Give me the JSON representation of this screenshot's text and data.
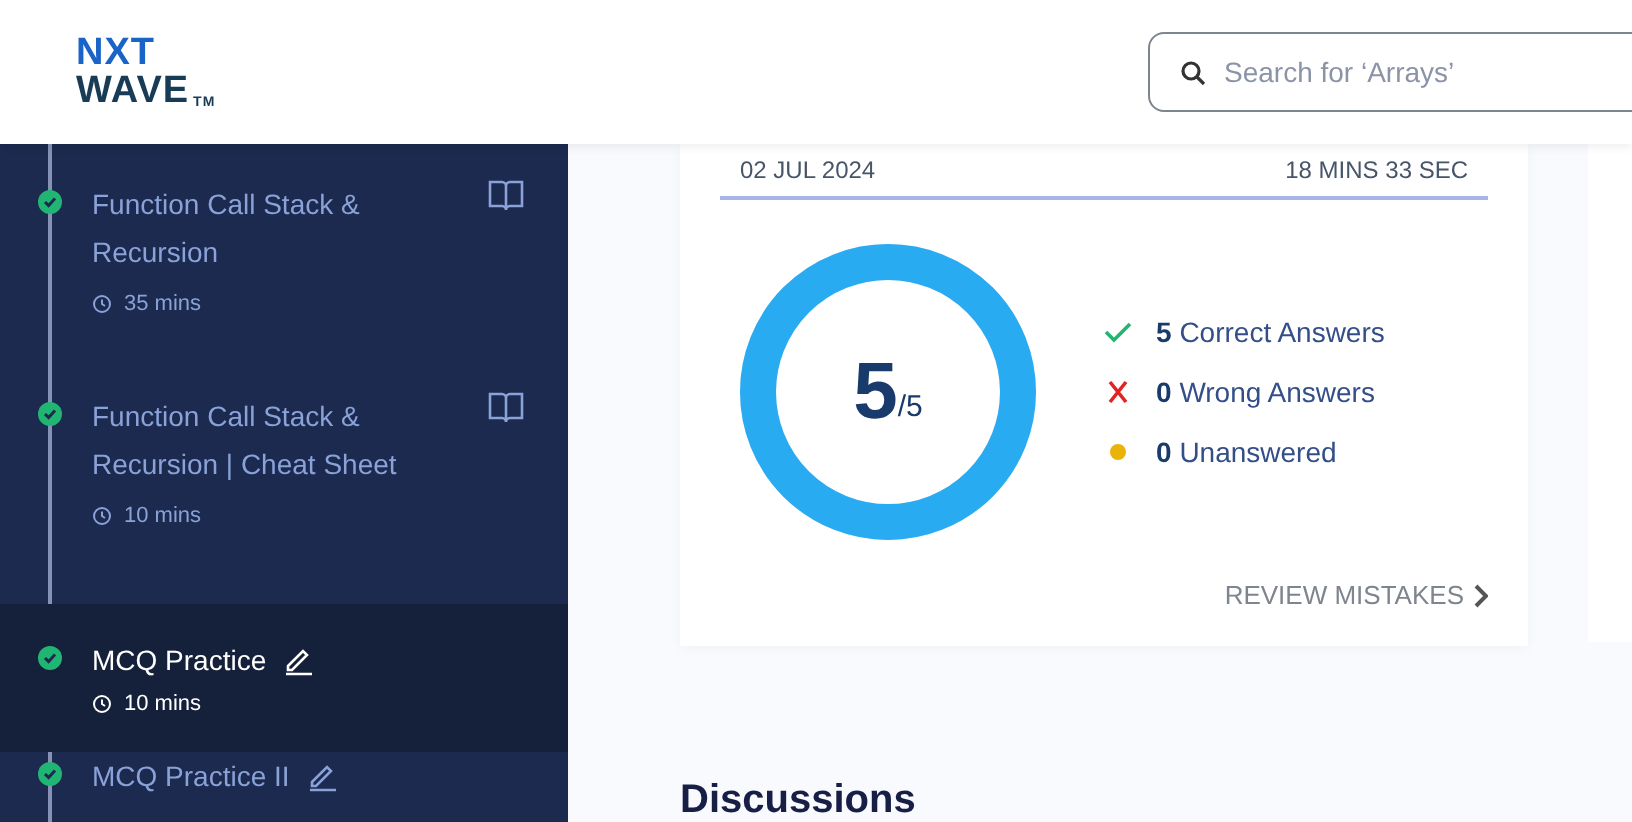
{
  "header": {
    "logo": {
      "line1": "NXT",
      "line2": "WAVE",
      "mark": "TM"
    },
    "search": {
      "placeholder": "Search for ‘Arrays’"
    }
  },
  "sidebar": {
    "items": [
      {
        "kind": "reading",
        "title": "Function Call Stack & Recursion",
        "duration": "35 mins",
        "completed": true,
        "selected": false
      },
      {
        "kind": "reading",
        "title": "Function Call Stack & Recursion | Cheat Sheet",
        "duration": "10 mins",
        "completed": true,
        "selected": false
      },
      {
        "kind": "practice",
        "title": "MCQ Practice",
        "duration": "10 mins",
        "completed": true,
        "selected": true
      },
      {
        "kind": "practice",
        "title": "MCQ Practice II",
        "completed": true,
        "selected": false
      }
    ]
  },
  "attempt": {
    "date": "02 JUL 2024",
    "time": "18 MINS 33 SEC",
    "score": "5",
    "total": "/5",
    "level": 1,
    "results": [
      {
        "kind": "correct",
        "count": "5",
        "label": "Correct Answers"
      },
      {
        "kind": "wrong",
        "count": "0",
        "label": "Wrong Answers"
      },
      {
        "kind": "unanswered",
        "count": "0",
        "label": "Unanswered"
      }
    ],
    "review": "REVIEW MISTAKES"
  },
  "discussions": {
    "title": "Discussions"
  }
}
